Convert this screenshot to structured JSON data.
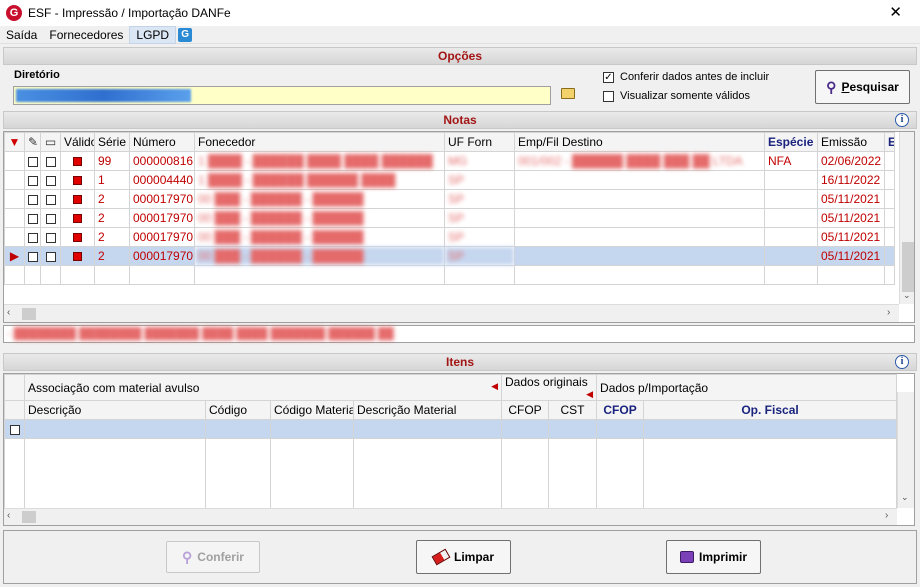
{
  "window": {
    "title": "ESF - Impressão / Importação DANFe",
    "close": "✕",
    "logo": "G"
  },
  "menu": {
    "items": [
      "Saída",
      "Fornecedores",
      "LGPD"
    ],
    "g_icon": "G"
  },
  "opcoes": {
    "header": "Opções",
    "diretorio_label": "Diretório",
    "diretorio_value": "",
    "conferir_label": "Conferir dados antes de incluir",
    "conferir_checked": "✓",
    "visualizar_label": "Visualizar somente válidos",
    "pesquisar_label": "Pesquisar",
    "pesquisar_accel": "P",
    "pesquisar_rest": "esquisar"
  },
  "notas": {
    "header": "Notas",
    "columns": [
      "Válido",
      "Série",
      "Número",
      "Fonecedor",
      "UF Forn",
      "Emp/Fil Destino",
      "Espécie",
      "Emissão",
      "E"
    ],
    "rows": [
      {
        "serie": "99",
        "numero": "000000816",
        "fornecedor": "1 ████ - ██████ ████ ████ ██████",
        "uf": "MG",
        "destino": "001/002 - ██████ ████ ███ ██ LTDA",
        "especie": "NFA",
        "emissao": "02/06/2022"
      },
      {
        "serie": "1",
        "numero": "000004440",
        "fornecedor": "1 ████ - ██████ ██████ ████",
        "uf": "SP",
        "destino": "",
        "especie": "",
        "emissao": "16/11/2022"
      },
      {
        "serie": "2",
        "numero": "000017970",
        "fornecedor": "00 ███ - ██████ - ██████",
        "uf": "SP",
        "destino": "",
        "especie": "",
        "emissao": "05/11/2021"
      },
      {
        "serie": "2",
        "numero": "000017970",
        "fornecedor": "00 ███ - ██████ - ██████",
        "uf": "SP",
        "destino": "",
        "especie": "",
        "emissao": "05/11/2021"
      },
      {
        "serie": "2",
        "numero": "000017970",
        "fornecedor": "00 ███ - ██████ - ██████",
        "uf": "SP",
        "destino": "",
        "especie": "",
        "emissao": "05/11/2021"
      },
      {
        "serie": "2",
        "numero": "000017970",
        "fornecedor": "00 ███ - ██████ - ██████",
        "uf": "SP",
        "destino": "",
        "especie": "",
        "emissao": "05/11/2021"
      }
    ],
    "message": "- ████████ ████████ ███████ ████ ████ ███████ ██████ ██"
  },
  "itens": {
    "header": "Itens",
    "group_assoc": "Associação com material avulso",
    "group_dados_orig": "Dados originais",
    "group_dados_imp": "Dados p/Importação",
    "columns": [
      "Descrição",
      "Código",
      "Código Material",
      "Descrição Material",
      "CFOP",
      "CST",
      "CFOP",
      "Op. Fiscal"
    ]
  },
  "footer": {
    "conferir_label": "Conferir",
    "limpar_label": "Limpar",
    "imprimir_label": "Imprimir"
  },
  "icons": {
    "folder": "folder-icon",
    "search": "search-icon",
    "info": "info-icon",
    "eraser": "eraser-icon",
    "printer": "printer-icon",
    "sort": "sort-desc-icon",
    "row_pointer": "row-pointer-icon"
  },
  "colors": {
    "accent_red": "#a31515",
    "selection": "#c5d6ef",
    "input_yellow": "#ffffc8"
  }
}
